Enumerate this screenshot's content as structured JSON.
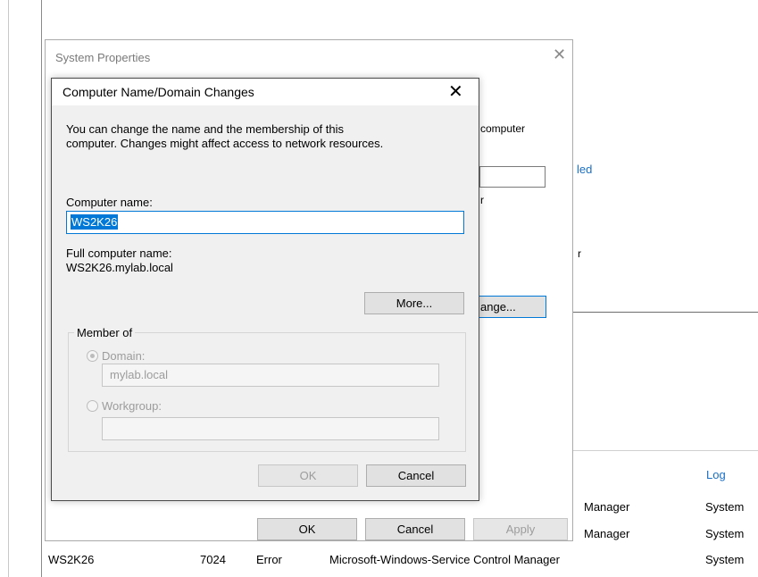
{
  "system_properties": {
    "title": "System Properties",
    "close_glyph": "✕",
    "background_texts": {
      "computer": "computer",
      "led": "led",
      "r1": "r",
      "r2": "r",
      "change_partial": "ange..."
    },
    "buttons": {
      "ok": "OK",
      "cancel": "Cancel",
      "apply": "Apply"
    }
  },
  "dialog": {
    "title": "Computer Name/Domain Changes",
    "close_glyph": "✕",
    "description_line1": "You can change the name and the membership of this",
    "description_line2": "computer. Changes might affect access to network resources.",
    "computer_name_label": "Computer name:",
    "computer_name_value": "WS2K26",
    "full_name_label": "Full computer name:",
    "full_name_value": "WS2K26.mylab.local",
    "more_button": "More...",
    "member_of_label": "Member of",
    "domain_label": "Domain:",
    "domain_value": "mylab.local",
    "workgroup_label": "Workgroup:",
    "workgroup_value": "",
    "ok_button": "OK",
    "cancel_button": "Cancel"
  },
  "event_log": {
    "header_log": "Log",
    "rows": [
      {
        "server": "",
        "id": "",
        "level": "",
        "source": "Manager",
        "log": "System"
      },
      {
        "server": "",
        "id": "",
        "level": "",
        "source": "Manager",
        "log": "System"
      },
      {
        "server": "WS2K26",
        "id": "7024",
        "level": "Error",
        "source": "Microsoft-Windows-Service Control Manager",
        "log": "System"
      }
    ]
  }
}
